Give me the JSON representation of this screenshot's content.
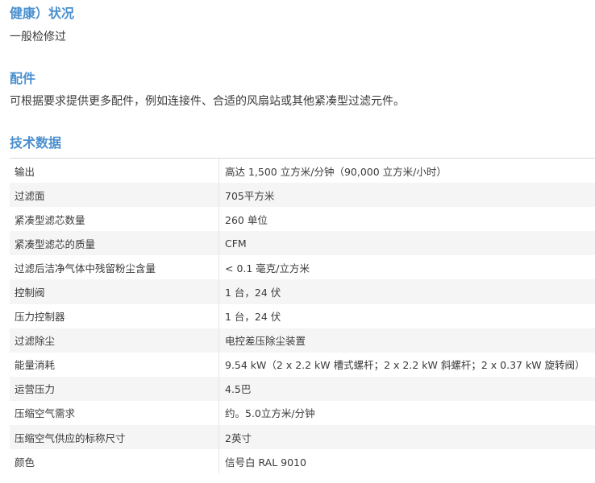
{
  "sections": {
    "condition": {
      "title": "健康）状况",
      "text": "一般检修过"
    },
    "accessories": {
      "title": "配件",
      "text": "可根据要求提供更多配件，例如连接件、合适的风扇站或其他紧凑型过滤元件。"
    },
    "tech": {
      "title": "技术数据"
    }
  },
  "specs": [
    {
      "label": "输出",
      "value": "高达 1,500 立方米/分钟（90,000 立方米/小时）"
    },
    {
      "label": "过滤面",
      "value": "705平方米"
    },
    {
      "label": "紧凑型滤芯数量",
      "value": "260 单位"
    },
    {
      "label": "紧凑型滤芯的质量",
      "value": "CFM"
    },
    {
      "label": "过滤后洁净气体中残留粉尘含量",
      "value": "< 0.1 毫克/立方米"
    },
    {
      "label": "控制阀",
      "value": "1 台，24 伏"
    },
    {
      "label": "压力控制器",
      "value": "1 台，24 伏"
    },
    {
      "label": "过滤除尘",
      "value": "电控差压除尘装置"
    },
    {
      "label": "能量消耗",
      "value": "9.54 kW（2 x 2.2 kW 槽式螺杆；2 x 2.2 kW 斜螺杆；2 x 0.37 kW 旋转阀）"
    },
    {
      "label": "运营压力",
      "value": "4.5巴"
    },
    {
      "label": "压缩空气需求",
      "value": "约。5.0立方米/分钟"
    },
    {
      "label": "压缩空气供应的标称尺寸",
      "value": "2英寸"
    },
    {
      "label": "颜色",
      "value": "信号白 RAL 9010"
    }
  ]
}
